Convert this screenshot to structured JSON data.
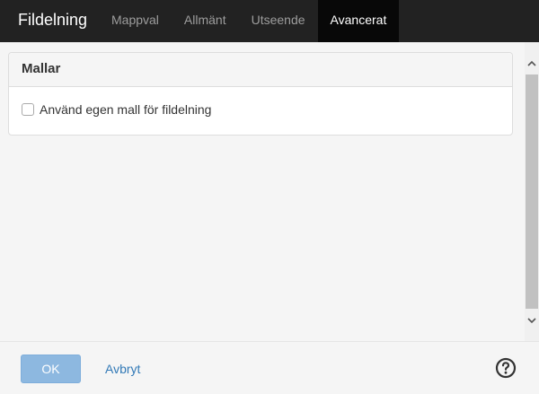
{
  "header": {
    "title": "Fildelning",
    "tabs": [
      {
        "label": "Mappval"
      },
      {
        "label": "Allmänt"
      },
      {
        "label": "Utseende"
      },
      {
        "label": "Avancerat"
      }
    ]
  },
  "panel": {
    "title": "Mallar",
    "checkbox_label": "Använd egen mall för fildelning"
  },
  "footer": {
    "ok_label": "OK",
    "cancel_label": "Avbryt"
  },
  "icons": {
    "help": "help-circle-icon",
    "scroll_up": "chevron-up-icon",
    "scroll_down": "chevron-down-icon"
  },
  "colors": {
    "topbar": "#222222",
    "active_tab": "#080808",
    "ok_button": "#8db8e0",
    "link": "#337ab7"
  }
}
